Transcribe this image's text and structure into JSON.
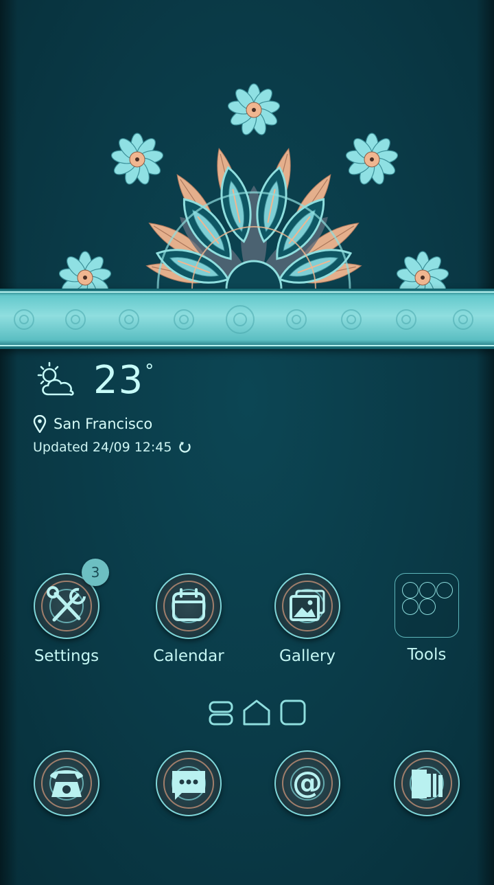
{
  "weather": {
    "temperature": "23",
    "unit": "°",
    "location": "San Francisco",
    "updated": "Updated 24/09 12:45",
    "icon": "partly-cloudy-icon"
  },
  "apps": [
    {
      "label": "Settings",
      "icon": "settings-icon",
      "badge": "3"
    },
    {
      "label": "Calendar",
      "icon": "calendar-icon"
    },
    {
      "label": "Gallery",
      "icon": "gallery-icon"
    },
    {
      "label": "Tools",
      "icon": "folder-icon"
    }
  ],
  "dock": [
    {
      "icon": "phone-icon"
    },
    {
      "icon": "messages-icon"
    },
    {
      "icon": "email-icon"
    },
    {
      "icon": "contacts-icon"
    }
  ],
  "colors": {
    "accent": "#8fdede",
    "background": "#0a3a47",
    "peach": "#f0b690",
    "text": "#c5f6f3"
  }
}
